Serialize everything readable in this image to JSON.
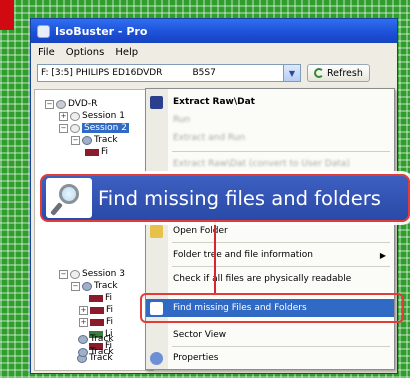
{
  "window": {
    "title": "IsoBuster - Pro"
  },
  "menu": {
    "items": [
      "File",
      "Options",
      "Help"
    ]
  },
  "drive": {
    "selected_drive": "F: [3:5] PHILIPS  ED16DVDR",
    "firmware": "B5S7",
    "refresh_label": "Refresh"
  },
  "tree": {
    "root": "DVD-R",
    "session1": "Session 1",
    "session2": "Session 2",
    "track1": "Track",
    "session3": "Session 3",
    "track2": "Track",
    "file_labels": [
      "Fi",
      "Fi",
      "Fi",
      "Fi",
      "Li",
      "Fi"
    ],
    "tracks_bottom": [
      "Track",
      "Track",
      "Track"
    ]
  },
  "context_menu": {
    "items": [
      {
        "label": "Extract Raw\\Dat",
        "style": "bold"
      },
      {
        "label": "Run",
        "style": "dim"
      },
      {
        "label": "Extract and Run",
        "style": "dim"
      },
      {
        "label": "Extract Raw\\Dat (convert to User Data)",
        "style": "dim"
      },
      {
        "label": "Open Folder",
        "style": "normal"
      },
      {
        "label": "Folder tree and file information",
        "style": "normal"
      },
      {
        "label": "Check if all files are physically readable",
        "style": "normal"
      },
      {
        "label": "Find missing Files and Folders",
        "style": "highlight"
      },
      {
        "label": "Sector View",
        "style": "normal"
      },
      {
        "label": "Properties",
        "style": "normal"
      }
    ]
  },
  "callout": {
    "text": "Find missing files and folders"
  },
  "colors": {
    "highlight": "#316ac5",
    "callout_border": "#e33a3a",
    "background": "#2f9e2c"
  }
}
